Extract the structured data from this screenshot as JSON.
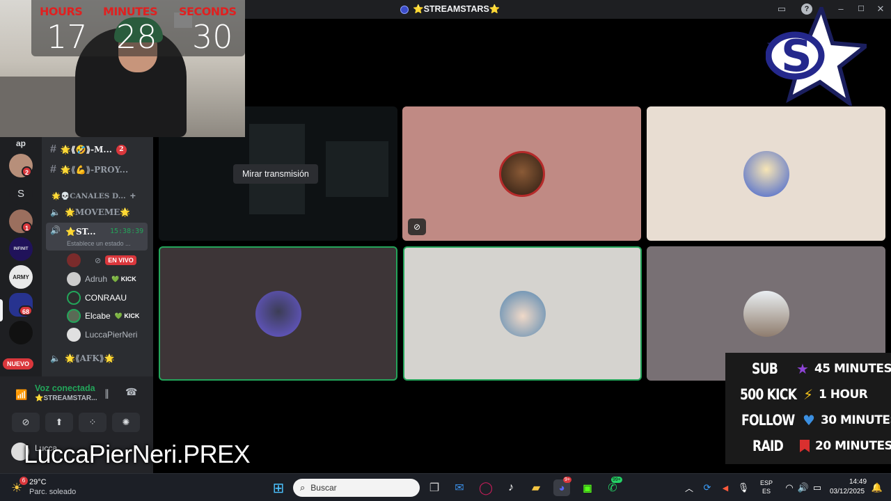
{
  "window": {
    "title": "⭐STREAMSTARS⭐",
    "app_icon": "discord-app-icon"
  },
  "overlay": {
    "timer": {
      "labels": {
        "hours": "HOURS",
        "minutes": "MINUTES",
        "seconds": "SECONDS"
      },
      "values": {
        "hours": "17",
        "minutes": "28",
        "seconds": "30"
      }
    },
    "streamer_name": "LuccaPierNeri.PREX",
    "goals": [
      {
        "label": "SUB",
        "icon": "star-icon",
        "icon_color": "#8e44d6",
        "value": "45 MINUTES"
      },
      {
        "label": "500 KICK",
        "icon": "lightning-icon",
        "icon_color": "#f4c21b",
        "value": "1 HOUR"
      },
      {
        "label": "FOLLOW",
        "icon": "heart-icon",
        "icon_color": "#3b8fe0",
        "value": "30 MINUTES"
      },
      {
        "label": "RAID",
        "icon": "bookmark-icon",
        "icon_color": "#d9302f",
        "value": "20 MINUTES"
      }
    ]
  },
  "servers": [
    {
      "label": "ap",
      "badge": ""
    },
    {
      "label": "",
      "badge": "2"
    },
    {
      "label": "S",
      "badge": ""
    },
    {
      "label": "",
      "badge": "1"
    },
    {
      "label": "INFINIT",
      "badge": ""
    },
    {
      "label": "ARMY",
      "badge": ""
    },
    {
      "label": "",
      "badge": "68"
    },
    {
      "label": "",
      "badge": ""
    },
    {
      "label": "NUEVO",
      "badge": ""
    }
  ],
  "channels": {
    "text": [
      {
        "name": "🌟⟪🤣⟫-M...",
        "badge": "2"
      },
      {
        "name": "🌟⟪💪⟫-PROY..."
      }
    ],
    "category": "🌟💀CANALES D...",
    "voice": [
      {
        "name": "🌟MOVEME🌟"
      },
      {
        "name": "⭐ST...",
        "time": "15:38:39",
        "status": "Establece un estado ..."
      }
    ],
    "afk": "🌟⟪AFK⟫🌟"
  },
  "members": [
    {
      "name": "",
      "tag": "EN VIVO"
    },
    {
      "name": "Adruh",
      "tag": "💚 KICK"
    },
    {
      "name": "CONRAAU",
      "tag": ""
    },
    {
      "name": "Elcabe",
      "tag": "💚 KICK"
    },
    {
      "name": "LuccaPierNeri",
      "tag": ""
    }
  ],
  "voice_panel": {
    "status": "Voz conectada",
    "channel": "⭐STREAMSTAR...",
    "user": "Lucca"
  },
  "stream_tile": {
    "watch_label": "Mirar transmisión"
  },
  "taskbar": {
    "weather_temp": "29°C",
    "weather_desc": "Parc. soleado",
    "weather_badge": "6",
    "search_placeholder": "Buscar",
    "lang_top": "ESP",
    "lang_bottom": "ES",
    "time": "14:49",
    "date": "03/12/2025",
    "discord_badge": "9+",
    "whatsapp_badge": "99+"
  }
}
